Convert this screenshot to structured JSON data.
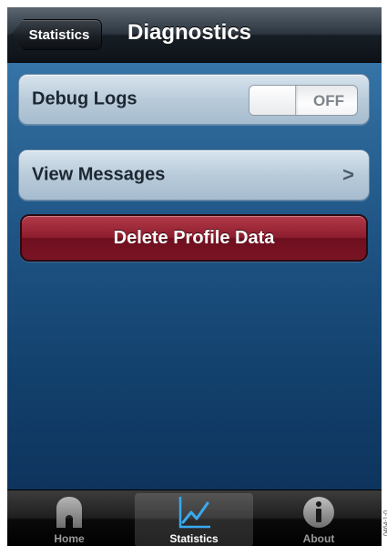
{
  "navbar": {
    "back_label": "Statistics",
    "title": "Diagnostics"
  },
  "settings": {
    "debug_logs_label": "Debug Logs",
    "debug_logs_state": "OFF",
    "view_messages_label": "View Messages",
    "chevron_glyph": ">"
  },
  "actions": {
    "delete_label": "Delete Profile Data"
  },
  "tabbar": {
    "tabs": [
      {
        "label": "Home",
        "icon": "home-icon"
      },
      {
        "label": "Statistics",
        "icon": "chart-icon",
        "selected": true
      },
      {
        "label": "About",
        "icon": "info-icon"
      }
    ]
  },
  "figure_id": "0464-1-0",
  "colors": {
    "background_top": "#3f7fb4",
    "background_bottom": "#0b2e55",
    "delete_button": "#8e1d2d"
  }
}
